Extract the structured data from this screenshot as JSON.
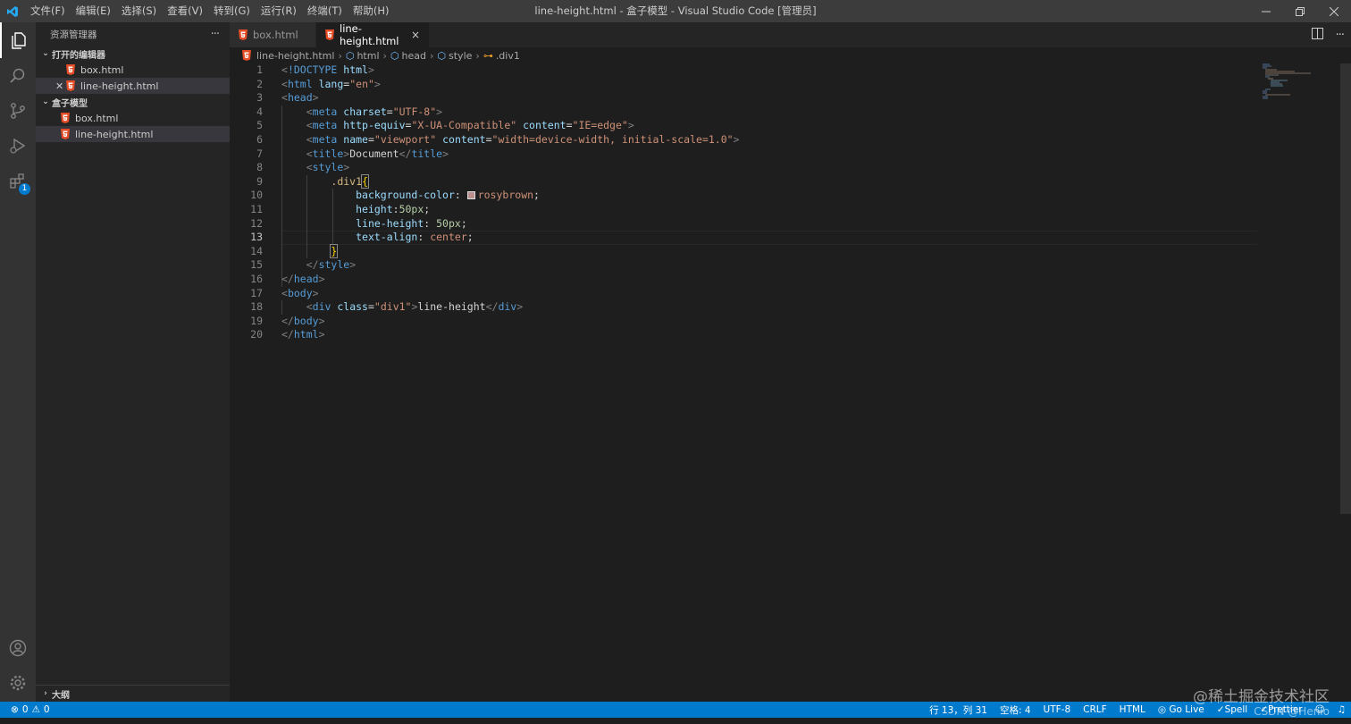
{
  "window": {
    "title": "line-height.html - 盒子模型 - Visual Studio Code [管理员]",
    "menu": [
      "文件(F)",
      "编辑(E)",
      "选择(S)",
      "查看(V)",
      "转到(G)",
      "运行(R)",
      "终端(T)",
      "帮助(H)"
    ]
  },
  "activity": {
    "extensions_badge": "1"
  },
  "sidebar": {
    "header": "资源管理器",
    "more": "···",
    "open_editors_title": "打开的编辑器",
    "open_editors": [
      "box.html",
      "line-height.html"
    ],
    "folder_title": "盒子模型",
    "files": [
      "box.html",
      "line-height.html"
    ],
    "outline_title": "大纲"
  },
  "tabs": [
    {
      "label": "box.html"
    },
    {
      "label": "line-height.html",
      "close": "×"
    }
  ],
  "breadcrumb": [
    "line-height.html",
    "html",
    "head",
    "style",
    ".div1"
  ],
  "editor": {
    "lines": [
      "1",
      "2",
      "3",
      "4",
      "5",
      "6",
      "7",
      "8",
      "9",
      "10",
      "11",
      "12",
      "13",
      "14",
      "15",
      "16",
      "17",
      "18",
      "19",
      "20"
    ],
    "current_line": "13"
  },
  "status": {
    "errors": "0",
    "warnings": "0",
    "position": "行 13，列 31",
    "spaces": "空格: 4",
    "encoding": "UTF-8",
    "eol": "CRLF",
    "language": "HTML",
    "golive": "Go Live",
    "spell": "Spell",
    "prettier": "Prettier"
  },
  "watermark": "@稀土掘金技术社区",
  "watermark2": "CSDN @Henio",
  "colors": {
    "accent": "#007acc",
    "swatch": "#bc8f8f"
  }
}
